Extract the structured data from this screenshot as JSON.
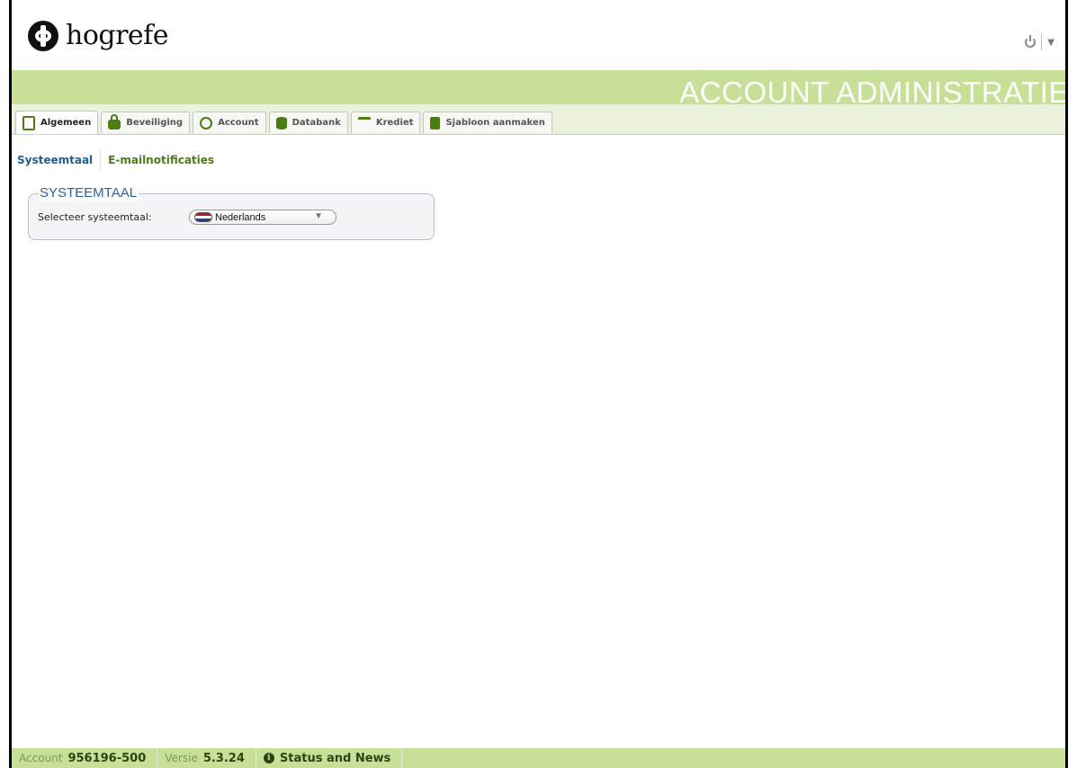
{
  "header": {
    "logo_text": "hogrefe",
    "app_title": "ACCOUNT ADMINISTRATIE"
  },
  "tabs": [
    {
      "label": "Algemeen",
      "icon": "general-icon",
      "active": true
    },
    {
      "label": "Beveiliging",
      "icon": "lock-icon",
      "active": false
    },
    {
      "label": "Account",
      "icon": "account-icon",
      "active": false
    },
    {
      "label": "Databank",
      "icon": "database-icon",
      "active": false
    },
    {
      "label": "Krediet",
      "icon": "scale-icon",
      "active": false
    },
    {
      "label": "Sjabloon aanmaken",
      "icon": "document-icon",
      "active": false
    }
  ],
  "subnav": [
    {
      "label": "Systeemtaal",
      "active": true
    },
    {
      "label": "E-mailnotificaties",
      "active": false
    }
  ],
  "language_panel": {
    "legend": "SYSTEEMTAAL",
    "label": "Selecteer systeemtaal:",
    "selected": "Nederlands",
    "flag_colors": [
      "#ae1c28",
      "#ffffff",
      "#21468b"
    ]
  },
  "footer": {
    "account_label": "Account",
    "account_value": "956196-500",
    "version_label": "Versie",
    "version_value": "5.3.24",
    "news_label": "Status and News"
  },
  "colors": {
    "accent_green": "#c8df98",
    "link_blue": "#1f5f93",
    "link_green": "#4f7a1a"
  }
}
